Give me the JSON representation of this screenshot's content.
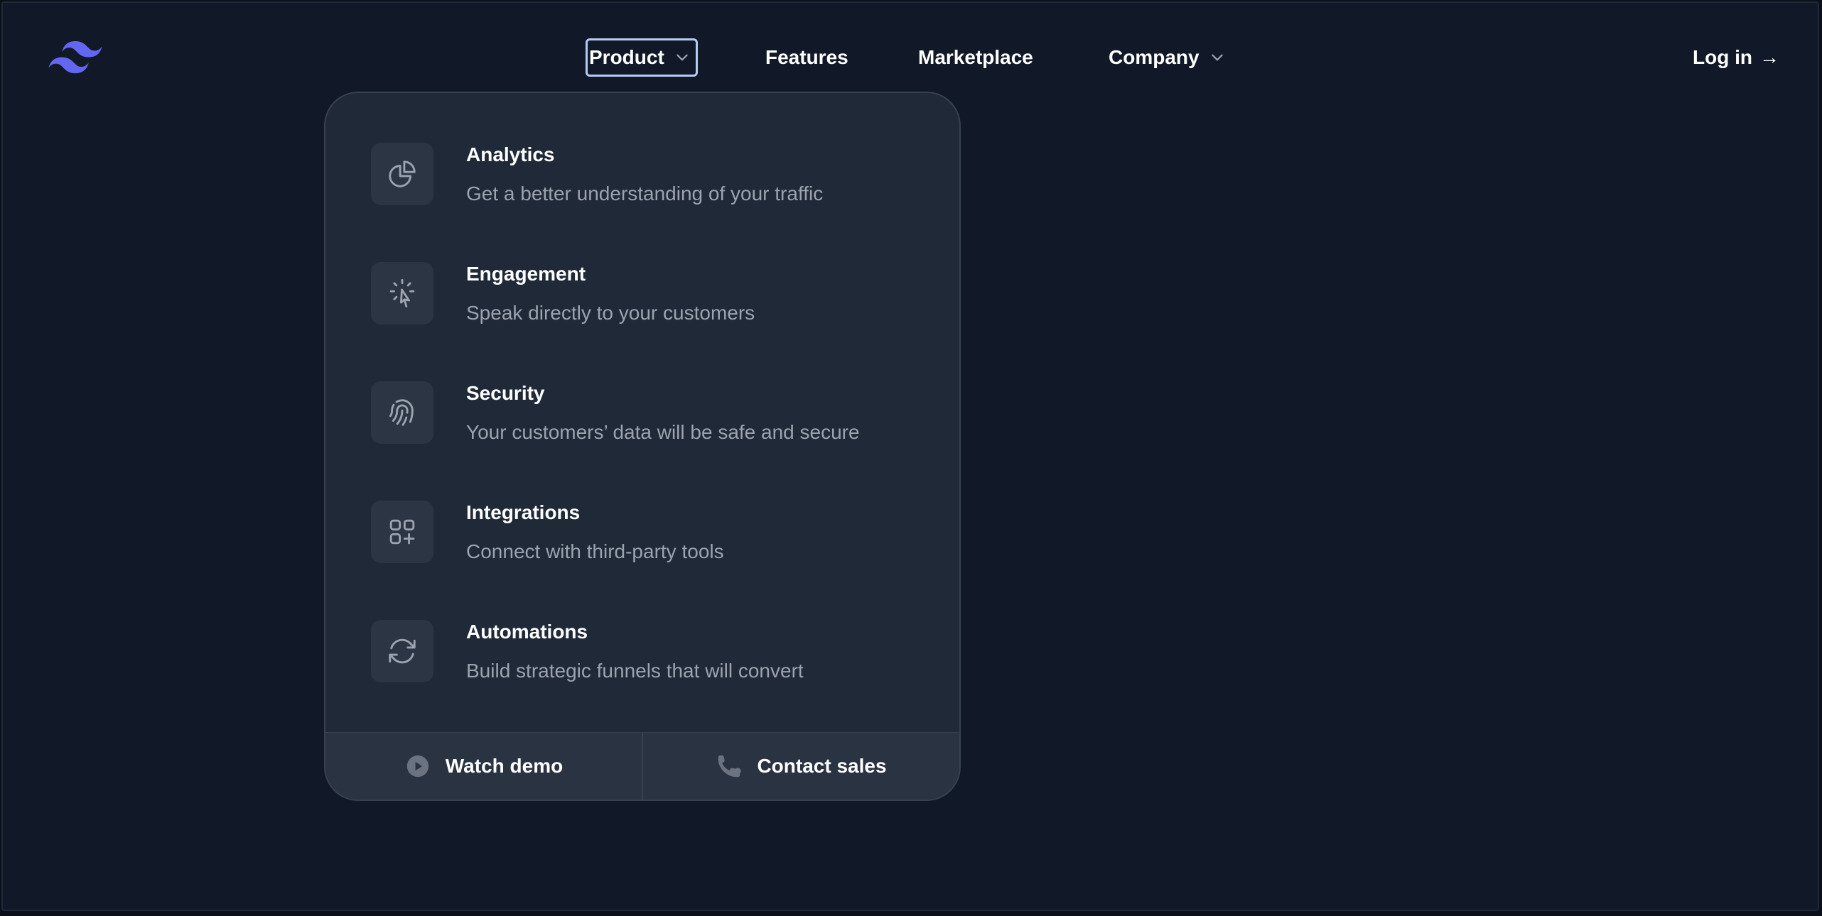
{
  "brand": {
    "logo_icon": "tailwind-wave-logo",
    "accent": "#6366f1"
  },
  "nav": {
    "product": "Product",
    "features": "Features",
    "marketplace": "Marketplace",
    "company": "Company",
    "login": "Log in",
    "login_arrow": "→"
  },
  "menu": {
    "items": [
      {
        "title": "Analytics",
        "desc": "Get a better understanding of your traffic",
        "icon": "chart-pie-icon"
      },
      {
        "title": "Engagement",
        "desc": "Speak directly to your customers",
        "icon": "cursor-click-icon"
      },
      {
        "title": "Security",
        "desc": "Your customers’ data will be safe and secure",
        "icon": "fingerprint-icon"
      },
      {
        "title": "Integrations",
        "desc": "Connect with third-party tools",
        "icon": "squares-plus-icon"
      },
      {
        "title": "Automations",
        "desc": "Build strategic funnels that will convert",
        "icon": "arrow-path-icon"
      }
    ],
    "footer": {
      "watch_demo": "Watch demo",
      "contact_sales": "Contact sales"
    }
  },
  "colors": {
    "background": "#111827",
    "panel": "#1f2937",
    "muted_text": "#9ca3af",
    "focus_ring": "#b5ccf7"
  }
}
